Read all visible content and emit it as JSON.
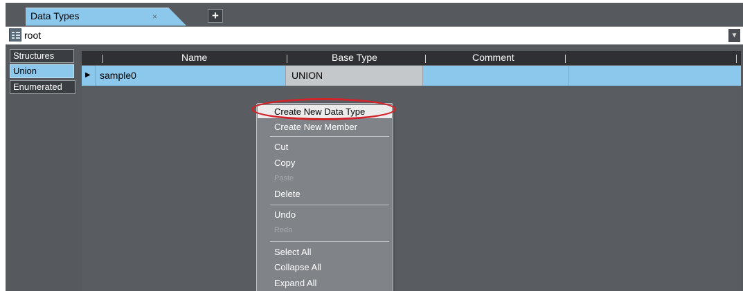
{
  "tab": {
    "label": "Data Types",
    "close": "×",
    "add": "+"
  },
  "path": {
    "value": "root",
    "dropdown_icon": "▼"
  },
  "categories": [
    "Structures",
    "Union",
    "Enumerated"
  ],
  "grid": {
    "columns": [
      "Name",
      "Base Type",
      "Comment"
    ],
    "rows": [
      {
        "marker": "▶",
        "name": "sample0",
        "base_type": "UNION",
        "comment": ""
      }
    ]
  },
  "context_menu": {
    "items": [
      "Create New Data Type",
      "Create New Member",
      "Cut",
      "Copy",
      "Paste",
      "Delete",
      "Undo",
      "Redo",
      "Select All",
      "Collapse All",
      "Expand All"
    ],
    "disabled": [
      "Paste",
      "Redo"
    ],
    "highlighted": "Create New Data Type"
  },
  "colors": {
    "selection": "#8cc8ec",
    "panel": "#56595d",
    "annotation": "#d2232a"
  }
}
